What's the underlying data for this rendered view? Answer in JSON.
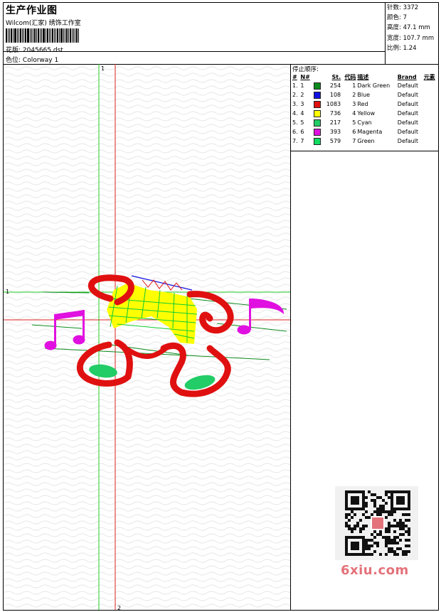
{
  "header": {
    "title": "生产作业图",
    "company": "Wilcom(汇家) 绣饰工作室",
    "design_label": "花版:",
    "design_value": "2045665.dst",
    "colorway_label": "色位:",
    "colorway_value": "Colorway 1"
  },
  "stats": {
    "stitches_label": "针数:",
    "stitches_value": "3372",
    "colors_label": "颜色:",
    "colors_value": "7",
    "height_label": "高度:",
    "height_value": "47.1 mm",
    "width_label": "宽度:",
    "width_value": "107.7 mm",
    "scale_label": "比例:",
    "scale_value": "1.24"
  },
  "canvas": {
    "marker_top": "1",
    "marker_left": "1",
    "marker_bottom": "2"
  },
  "stop_sequence": {
    "title": "停止顺序:",
    "headers": [
      "#",
      "N#",
      "St.",
      "代码",
      "描述",
      "Brand",
      "元素"
    ],
    "rows": [
      {
        "idx": "1.",
        "n": "1",
        "color": "#0e8a1e",
        "st": "254",
        "code": "1",
        "desc": "Dark Green",
        "brand": "Default"
      },
      {
        "idx": "2.",
        "n": "2",
        "color": "#1010e0",
        "st": "108",
        "code": "2",
        "desc": "Blue",
        "brand": "Default"
      },
      {
        "idx": "3.",
        "n": "3",
        "color": "#e01010",
        "st": "1083",
        "code": "3",
        "desc": "Red",
        "brand": "Default"
      },
      {
        "idx": "4.",
        "n": "4",
        "color": "#ffff00",
        "st": "736",
        "code": "4",
        "desc": "Yellow",
        "brand": "Default"
      },
      {
        "idx": "5.",
        "n": "5",
        "color": "#22cc66",
        "st": "217",
        "code": "5",
        "desc": "Cyan",
        "brand": "Default"
      },
      {
        "idx": "6.",
        "n": "6",
        "color": "#e010e0",
        "st": "393",
        "code": "6",
        "desc": "Magenta",
        "brand": "Default"
      },
      {
        "idx": "7.",
        "n": "7",
        "color": "#10dd60",
        "st": "579",
        "code": "7",
        "desc": "Green",
        "brand": "Default"
      }
    ]
  },
  "watermark": "6xiu.com",
  "icons": {
    "qr": "qr-code-icon"
  }
}
